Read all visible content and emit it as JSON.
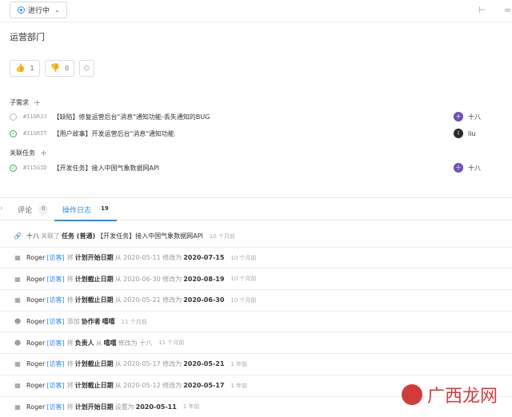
{
  "topbar": {
    "status_label": "进行中"
  },
  "title": "运营部门",
  "reactions": {
    "like_count": "1",
    "dislike_count": "0"
  },
  "sub_requirements": {
    "label": "子需求",
    "items": [
      {
        "code": "#I1GRJJ",
        "title": "【缺陷】修复运营后台\"消息\"通知功能-丢失通知的BUG",
        "assignee": "十八",
        "avatar": "十",
        "done": false
      },
      {
        "code": "#I1GRIT",
        "title": "【用户故事】开发运营后台\"消息\"通知功能",
        "assignee": "liu",
        "avatar": "l",
        "done": true
      }
    ]
  },
  "related_tasks": {
    "label": "关联任务",
    "items": [
      {
        "code": "#I15GID",
        "title": "【开发任务】接入中国气象数据网API",
        "assignee": "十八",
        "avatar": "十",
        "done": true
      }
    ]
  },
  "tabs": [
    {
      "label": "评论",
      "count": "0"
    },
    {
      "label": "操作日志",
      "count": "19"
    }
  ],
  "logs": [
    {
      "icon": "link-icon",
      "user": "十八",
      "role": "",
      "a": "关联了",
      "b": "任务 (普通)",
      "c": "【开发任务】接入中国气象数据网API",
      "d": "",
      "e": "",
      "time": "10 个月前"
    },
    {
      "icon": "calendar-icon",
      "user": "Roger",
      "role": "[访客]",
      "a": "将",
      "b": "计划开始日期",
      "c": "从 2020-05-11 修改为",
      "d": "2020-07-15",
      "e": "",
      "time": "10 个月前"
    },
    {
      "icon": "calendar-check-icon",
      "user": "Roger",
      "role": "[访客]",
      "a": "将",
      "b": "计划截止日期",
      "c": "从 2020-06-30 修改为",
      "d": "2020-08-19",
      "e": "",
      "time": "10 个月前"
    },
    {
      "icon": "calendar-check-icon",
      "user": "Roger",
      "role": "[访客]",
      "a": "将",
      "b": "计划截止日期",
      "c": "从 2020-05-21 修改为",
      "d": "2020-06-30",
      "e": "",
      "time": "10 个月前"
    },
    {
      "icon": "user-add-icon",
      "user": "Roger",
      "role": "[访客]",
      "a": "添加",
      "b": "协作者",
      "c": "",
      "d": "嘻嘻",
      "e": "",
      "time": "11 个月前"
    },
    {
      "icon": "user-add-icon",
      "user": "Roger",
      "role": "[访客]",
      "a": "将",
      "b": "负责人",
      "c": "从",
      "d": "嘻嘻",
      "e": "修改为 十八",
      "time": "11 个月前"
    },
    {
      "icon": "calendar-check-icon",
      "user": "Roger",
      "role": "[访客]",
      "a": "将",
      "b": "计划截止日期",
      "c": "从 2020-05-17 修改为",
      "d": "2020-05-21",
      "e": "",
      "time": "1 年前"
    },
    {
      "icon": "calendar-check-icon",
      "user": "Roger",
      "role": "[访客]",
      "a": "将",
      "b": "计划截止日期",
      "c": "从 2020-05-12 修改为",
      "d": "2020-05-17",
      "e": "",
      "time": "1 年前"
    },
    {
      "icon": "calendar-icon",
      "user": "Roger",
      "role": "[访客]",
      "a": "将",
      "b": "计划开始日期",
      "c": "设置为",
      "d": "2020-05-11",
      "e": "",
      "time": "1 年前"
    }
  ],
  "watermark": "广西龙网"
}
